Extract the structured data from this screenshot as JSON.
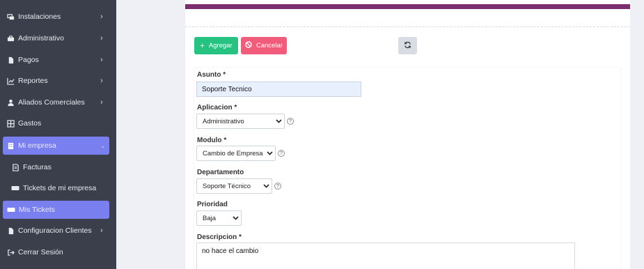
{
  "sidebar": {
    "items": [
      {
        "label": "Instalaciones",
        "icon": "installations-icon",
        "chevron": "›"
      },
      {
        "label": "Administrativo",
        "icon": "briefcase-icon",
        "chevron": "›"
      },
      {
        "label": "Pagos",
        "icon": "document-icon",
        "chevron": "›"
      },
      {
        "label": "Reportes",
        "icon": "chart-line-icon",
        "chevron": "›"
      },
      {
        "label": "Aliados Comerciales",
        "icon": "user-icon",
        "chevron": "›"
      },
      {
        "label": "Gastos",
        "icon": "grid-icon",
        "chevron": ""
      },
      {
        "label": "Mi empresa",
        "icon": "building-icon",
        "chevron": "⌄",
        "active": true
      },
      {
        "label": "Facturas",
        "icon": "invoice-icon",
        "chevron": ""
      },
      {
        "label": "Tickets de mi empresa",
        "icon": "ticket-icon",
        "chevron": ""
      },
      {
        "label": "Mis Tickets",
        "icon": "ticket-icon",
        "chevron": "",
        "active": true
      },
      {
        "label": "Configuracion Clientes",
        "icon": "document-icon",
        "chevron": "›"
      },
      {
        "label": "Cerrar Sesión",
        "icon": "logout-icon",
        "chevron": ""
      }
    ]
  },
  "toolbar": {
    "add_label": "Agregar",
    "cancel_label": "Cancelar"
  },
  "form": {
    "asunto": {
      "label": "Asunto *",
      "value": "Soporte Tecnico"
    },
    "aplicacion": {
      "label": "Aplicacion *",
      "value": "Administrativo"
    },
    "modulo": {
      "label": "Modulo *",
      "value": "Cambio de Empresa"
    },
    "departamento": {
      "label": "Departamento",
      "value": "Soporte Técnico"
    },
    "prioridad": {
      "label": "Prioridad",
      "value": "Baja"
    },
    "descripcion": {
      "label": "Descripcion *",
      "value": "no hace el cambio"
    }
  },
  "colors": {
    "sidebar_bg": "#3a3f4b",
    "sidebar_active": "#7a7ff0",
    "card_topbar": "#7c2d6e",
    "add_button": "#26c281",
    "cancel_button": "#f05c7a"
  }
}
